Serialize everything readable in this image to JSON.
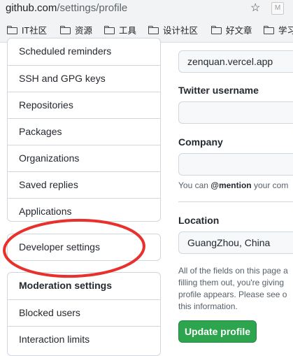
{
  "browser": {
    "url_host": "github.com",
    "url_path": "/settings/profile",
    "bookmarks": [
      {
        "label": "IT社区"
      },
      {
        "label": "资源"
      },
      {
        "label": "工具"
      },
      {
        "label": "设计社区"
      },
      {
        "label": "好文章"
      },
      {
        "label": "学习"
      }
    ]
  },
  "sidebar": {
    "group1": [
      "Scheduled reminders",
      "SSH and GPG keys",
      "Repositories",
      "Packages",
      "Organizations",
      "Saved replies",
      "Applications"
    ],
    "developer": "Developer settings",
    "moderation_heading": "Moderation settings",
    "moderation": [
      "Blocked users",
      "Interaction limits"
    ]
  },
  "main": {
    "url_value": "zenquan.vercel.app",
    "twitter_label": "Twitter username",
    "company_label": "Company",
    "company_note_pre": "You can ",
    "company_note_mention": "@mention",
    "company_note_post": " your com",
    "location_label": "Location",
    "location_value": "GuangZhou, China",
    "disclaimer": [
      "All of the fields on this page a",
      "filling them out, you're giving",
      "profile appears. Please see o",
      "this information."
    ],
    "update_button": "Update profile"
  },
  "colors": {
    "primary_button": "#2da44e",
    "annotation_circle": "#e8302c"
  }
}
